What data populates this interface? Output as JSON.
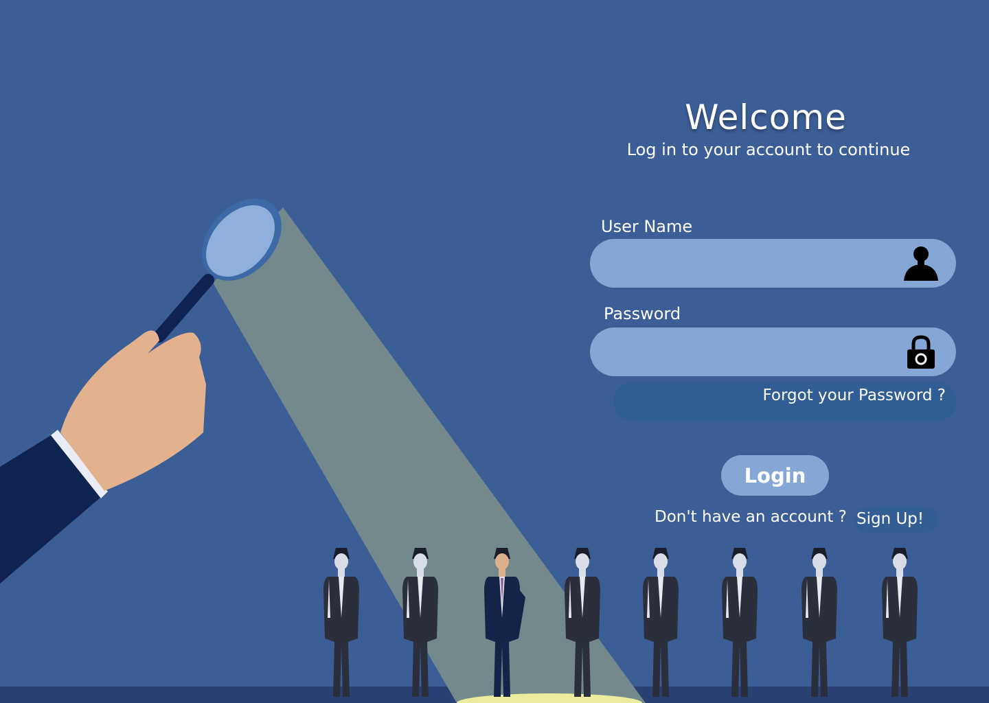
{
  "header": {
    "title": "Welcome",
    "subtitle": "Log in to your account to continue"
  },
  "form": {
    "username": {
      "label": "User Name",
      "value": "",
      "placeholder": "",
      "icon": "user-icon"
    },
    "password": {
      "label": "Password",
      "value": "",
      "placeholder": "",
      "icon": "lock-icon"
    },
    "forgot_label": "Forgot your Password ?",
    "login_label": "Login"
  },
  "signup": {
    "prompt": "Don't have an account ?",
    "link_label": "Sign Up!"
  },
  "illustration": {
    "subject": "hand holding magnifying glass spotlighting one businessman in a row of eight",
    "icon": "magnifying-glass-icon"
  },
  "colors": {
    "background": "#3c5e97",
    "input_fill": "#84a7d6",
    "button_fill": "#84a7d6",
    "link_pill": "#2f5d94",
    "text": "#ffffff"
  }
}
